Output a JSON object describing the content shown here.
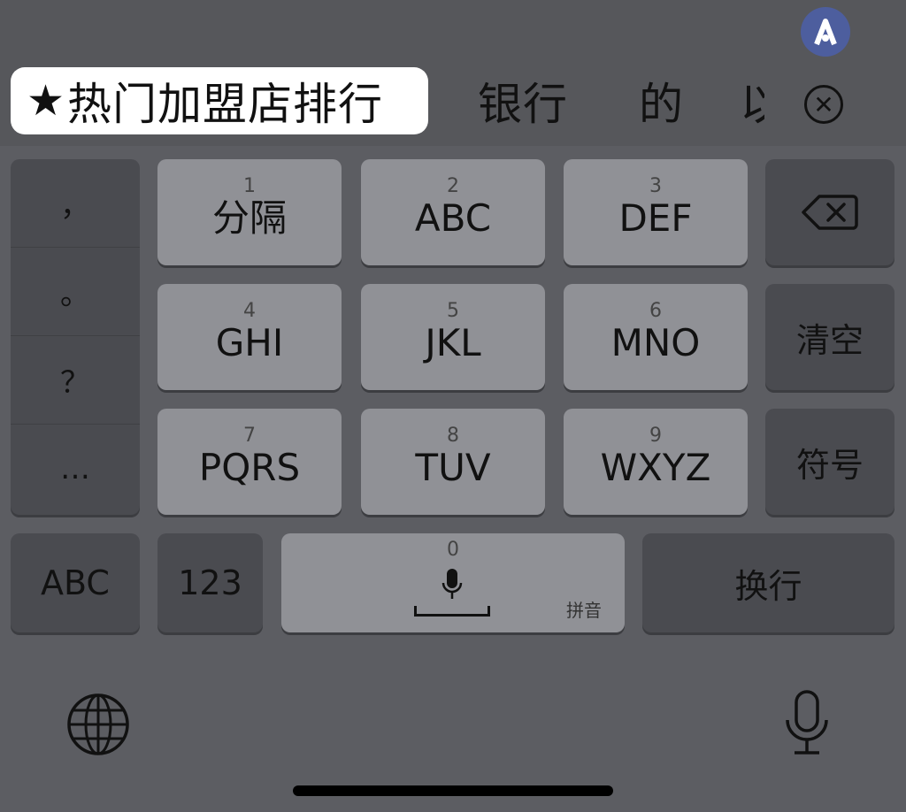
{
  "candidates": {
    "selected": "热门加盟店排行",
    "items": [
      "银行",
      "的",
      "以"
    ]
  },
  "keys": {
    "row1": [
      {
        "num": "1",
        "letters": "分隔"
      },
      {
        "num": "2",
        "letters": "ABC"
      },
      {
        "num": "3",
        "letters": "DEF"
      }
    ],
    "row2": [
      {
        "num": "4",
        "letters": "GHI"
      },
      {
        "num": "5",
        "letters": "JKL"
      },
      {
        "num": "6",
        "letters": "MNO"
      }
    ],
    "row3": [
      {
        "num": "7",
        "letters": "PQRS"
      },
      {
        "num": "8",
        "letters": "TUV"
      },
      {
        "num": "9",
        "letters": "WXYZ"
      }
    ],
    "punctuation": [
      "，",
      "。",
      "？",
      "…"
    ],
    "clear": "清空",
    "symbols": "符号",
    "abc": "ABC",
    "numbers": "123",
    "space_number": "0",
    "space_mode": "拼音",
    "enter": "换行"
  },
  "icons": {
    "assistant": "assistant-icon",
    "dismiss": "close-circle-icon",
    "delete": "backspace-icon",
    "globe": "globe-icon",
    "microphone": "microphone-icon"
  },
  "colors": {
    "keyboard_bg": "#5c5d62",
    "light_key": "#909196",
    "dark_key": "#4a4b50",
    "selected_candidate_bg": "#ffffff"
  }
}
